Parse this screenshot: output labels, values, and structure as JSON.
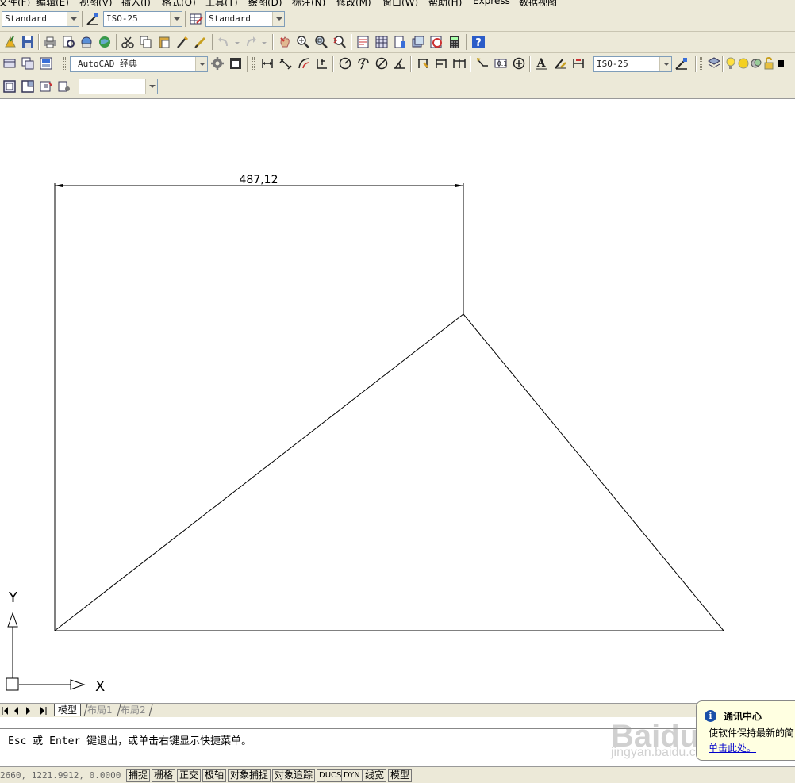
{
  "menu": [
    "文件(F)",
    "编辑(E)",
    "视图(V)",
    "插入(I)",
    "格式(O)",
    "工具(T)",
    "绘图(D)",
    "标注(N)",
    "修改(M)",
    "窗口(W)",
    "帮助(H)",
    "Express",
    "数据视图"
  ],
  "toolbar1": {
    "text_style": "Standard",
    "dim_style": "ISO-25",
    "table_style": "Standard"
  },
  "toolbar3": {
    "workspace": "AutoCAD 经典",
    "dim_style": "ISO-25"
  },
  "toolbar4": {
    "layer_combo": ""
  },
  "drawing": {
    "dimension_text": "487,12",
    "ucs_y": "Y",
    "ucs_x": "X"
  },
  "tabs": [
    "模型",
    "布局1",
    "布局2"
  ],
  "command": {
    "prompt": "Esc 或 Enter 键退出，或单击右键显示快捷菜单。"
  },
  "status": {
    "coords": "2660, 1221.9912, 0.0000",
    "buttons": [
      "捕捉",
      "栅格",
      "正交",
      "极轴",
      "对象捕捉",
      "对象追踪",
      "DUCS",
      "DYN",
      "线宽",
      "模型"
    ]
  },
  "notification": {
    "title": "通讯中心",
    "body": "使软件保持最新的简单",
    "link": "单击此处。"
  },
  "watermark": {
    "main": "Baidu经验",
    "sub": "jingyan.baidu.com"
  }
}
